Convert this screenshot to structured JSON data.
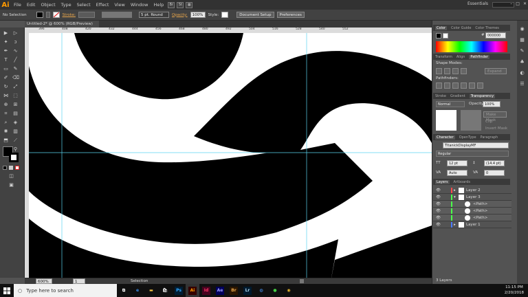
{
  "app": {
    "logo": "Ai",
    "essentials": "Essentials"
  },
  "menu": [
    "File",
    "Edit",
    "Object",
    "Type",
    "Select",
    "Effect",
    "View",
    "Window",
    "Help"
  ],
  "window_buttons": [
    "Br",
    "St"
  ],
  "control_bar": {
    "selection_label": "No Selection",
    "stroke_label": "Stroke:",
    "brush_label": "5 pt. Round",
    "opacity_label": "Opacity:",
    "opacity_value": "100%",
    "style_label": "Style:",
    "doc_setup": "Document Setup",
    "preferences": "Preferences"
  },
  "document_tab": "Untitled-2* @ 600% (RGB/Preview)",
  "ruler_ticks": [
    "396",
    "408",
    "420",
    "432",
    "444",
    "456",
    "468",
    "480",
    "492",
    "504",
    "516",
    "528",
    "540",
    "552"
  ],
  "right_panel": {
    "color_tabs": [
      "Color",
      "Color Guide",
      "Color Themes"
    ],
    "hex_value": "000000",
    "pathfinder_tabs": [
      "Transform",
      "Align",
      "Pathfinder"
    ],
    "shape_modes": "Shape Modes:",
    "expand": "Expand",
    "pathfinders": "Pathfinders:",
    "transparency_tabs": [
      "Stroke",
      "Gradient",
      "Transparency"
    ],
    "blend_mode": "Normal",
    "opacity_label": "Opacity:",
    "opacity_value": "100%",
    "make_mask": "Make Mask",
    "clip": "Clip",
    "invert_mask": "Invert Mask",
    "character_tabs": [
      "Character",
      "OpenType",
      "Paragraph"
    ],
    "font_name": "TItanickDisplayMF",
    "font_style": "Regular",
    "font_size": "12 pt",
    "leading": "(14.4 pt)",
    "kerning": "Auto",
    "tracking": "0",
    "layers_tabs": [
      "Layers",
      "Artboards"
    ],
    "layers": [
      {
        "name": "Layer 2",
        "color": "#ff4b4b",
        "indent": 0
      },
      {
        "name": "Layer 3",
        "color": "#4bff4b",
        "indent": 0
      },
      {
        "name": "<Path>",
        "color": "#4bff4b",
        "indent": 1
      },
      {
        "name": "<Path>",
        "color": "#4bff4b",
        "indent": 1
      },
      {
        "name": "<Path>",
        "color": "#4bff4b",
        "indent": 1
      },
      {
        "name": "Layer 1",
        "color": "#4b7bff",
        "indent": 0
      }
    ],
    "layers_count": "3 Layers"
  },
  "status": {
    "zoom": "600%",
    "page": "1",
    "mode": "Selection"
  },
  "taskbar": {
    "search_placeholder": "Type here to search",
    "apps": [
      "Ps",
      "Ai",
      "Id",
      "Ae",
      "Br",
      "Lr"
    ],
    "time": "11:15 PM",
    "date": "2/20/2018"
  }
}
